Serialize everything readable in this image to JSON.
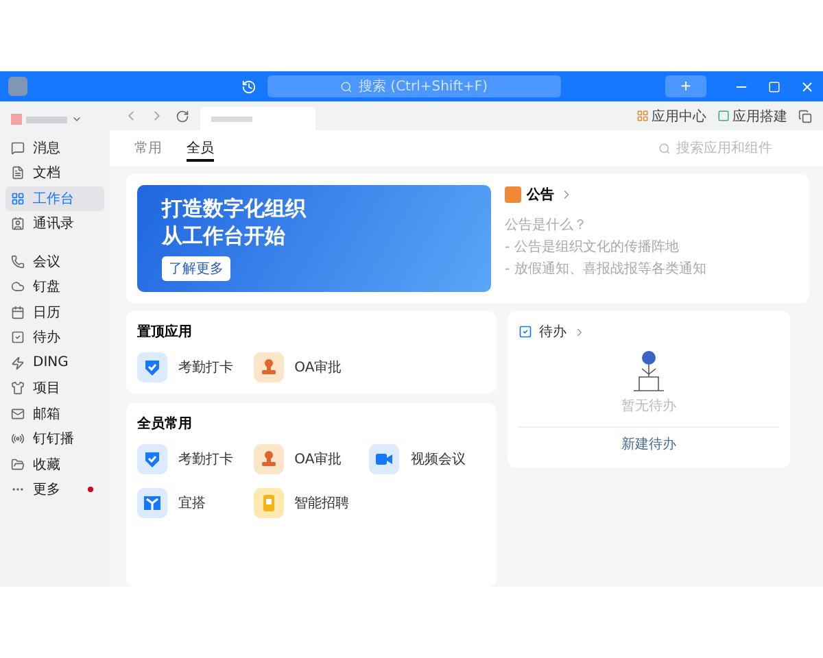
{
  "titlebar": {
    "search": {
      "placeholder": "搜索 (Ctrl+Shift+F)"
    },
    "add_button": "+"
  },
  "sidebar": {
    "items": [
      {
        "label": "消息",
        "selected": false,
        "badge": false
      },
      {
        "label": "文档",
        "selected": false,
        "badge": false
      },
      {
        "label": "工作台",
        "selected": true,
        "badge": false
      },
      {
        "label": "通讯录",
        "selected": false,
        "badge": false
      },
      {
        "label": "会议",
        "selected": false,
        "badge": false
      },
      {
        "label": "钉盘",
        "selected": false,
        "badge": false
      },
      {
        "label": "日历",
        "selected": false,
        "badge": false
      },
      {
        "label": "待办",
        "selected": false,
        "badge": false
      },
      {
        "label": "DING",
        "selected": false,
        "badge": false
      },
      {
        "label": "项目",
        "selected": false,
        "badge": false
      },
      {
        "label": "邮箱",
        "selected": false,
        "badge": false
      },
      {
        "label": "钉钉播",
        "selected": false,
        "badge": false
      },
      {
        "label": "收藏",
        "selected": false,
        "badge": false
      },
      {
        "label": "更多",
        "selected": false,
        "badge": true
      }
    ]
  },
  "toolbar": {
    "links": [
      "应用中心",
      "应用搭建"
    ]
  },
  "tabs": [
    {
      "label": "常用",
      "selected": false
    },
    {
      "label": "全员",
      "selected": true
    }
  ],
  "app_search": {
    "placeholder": "搜索应用和组件"
  },
  "banner": {
    "lines": [
      "打造数字化组织",
      "从工作台开始"
    ],
    "button": "了解更多"
  },
  "announcement": {
    "title": "公告",
    "lines": [
      "公告是什么？",
      "- 公告是组织文化的传播阵地",
      "- 放假通知、喜报战报等各类通知"
    ]
  },
  "pinned": {
    "title": "置顶应用",
    "apps": [
      "考勤打卡",
      "OA审批"
    ]
  },
  "common": {
    "title": "全员常用",
    "apps": [
      "考勤打卡",
      "OA审批",
      "视频会议",
      "宜搭",
      "智能招聘"
    ]
  },
  "todo": {
    "title": "待办",
    "empty": "暂无待办",
    "action": "新建待办"
  }
}
